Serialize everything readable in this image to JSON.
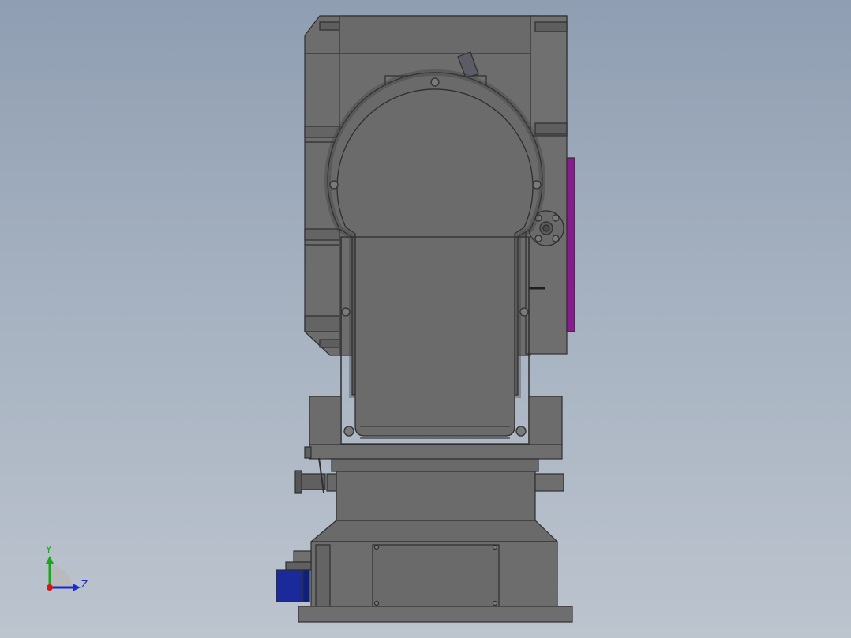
{
  "viewport": {
    "background_top": "#8f9eb2",
    "background_bottom": "#bcc4ce"
  },
  "model": {
    "body_color": "#6b6b6b",
    "dark_color": "#5e5e5e",
    "light_color": "#7a7a7a",
    "outline_color": "#2e2e2e",
    "accent_magenta": "#8a1a8f",
    "accent_blue": "#1a2a9a"
  },
  "triad": {
    "y_label": "Y",
    "z_label": "Z",
    "y_color": "#1aa51a",
    "z_color": "#1a2ad0",
    "origin_color": "#d01a1a"
  }
}
